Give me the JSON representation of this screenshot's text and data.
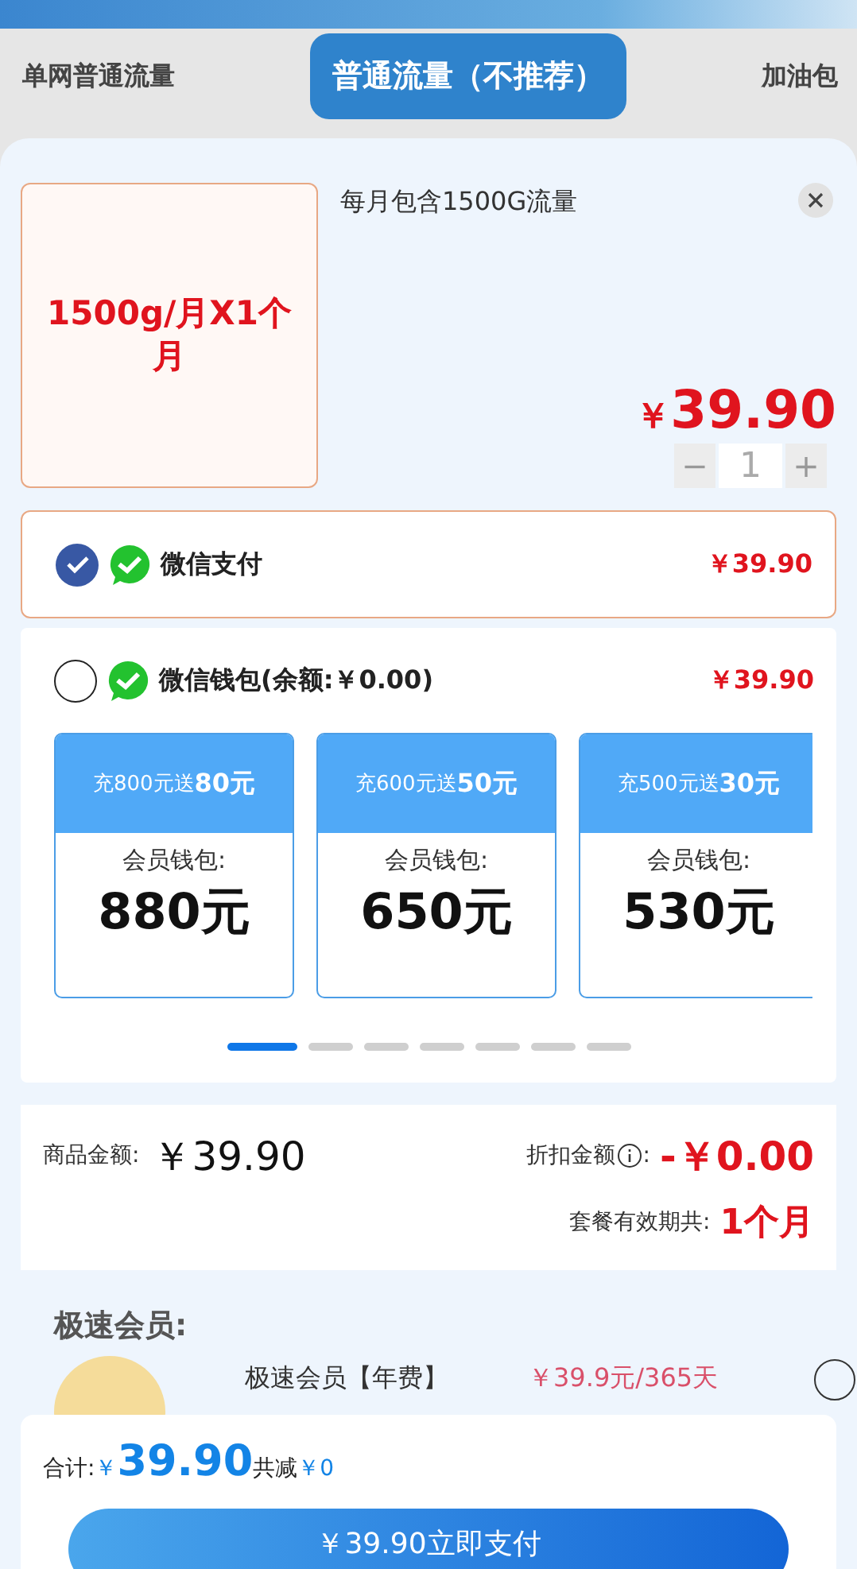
{
  "tabs": [
    {
      "label": "单网普通流量",
      "selected": false
    },
    {
      "label": "普通流量（不推荐）",
      "selected": true
    },
    {
      "label": "加油包",
      "selected": false
    }
  ],
  "product": {
    "card_text": "1500g/月X1个月",
    "description": "每月包含1500G流量",
    "price_symbol": "￥",
    "price": "39.90",
    "quantity": "1",
    "minus": "−",
    "plus": "+"
  },
  "payment_methods": [
    {
      "kind": "plain",
      "label": "微信支付",
      "price": "￥39.90",
      "selected": true
    },
    {
      "kind": "wallet",
      "label": "微信钱包(余额:￥0.00)",
      "price": "￥39.90",
      "selected": false
    }
  ],
  "wallet_offers": [
    {
      "promo": "充800元送**80元**",
      "label": "会员钱包:",
      "amount": "880元"
    },
    {
      "promo": "充600元送**50元**",
      "label": "会员钱包:",
      "amount": "650元"
    },
    {
      "promo": "充500元送**30元**",
      "label": "会员钱包:",
      "amount": "530元"
    }
  ],
  "pager": [
    {
      "selected": true
    },
    {
      "selected": false
    },
    {
      "selected": false
    },
    {
      "selected": false
    },
    {
      "selected": false
    },
    {
      "selected": false
    },
    {
      "selected": false
    }
  ],
  "summary": {
    "goods_label": "商品金额:",
    "goods_amount": "￥39.90",
    "discount_label": "折扣金额",
    "discount_suffix": ":",
    "discount_amount": "-￥0.00",
    "validity_label": "套餐有效期共:",
    "validity_value": "1个月"
  },
  "member": {
    "heading": "极速会员:",
    "item_name": "极速会员【年费】",
    "item_price": "￥39.9元/365天",
    "selected": false
  },
  "footer": {
    "total_label": "合计:",
    "total_symbol": "￥",
    "total_amount": "39.90",
    "saved_label": "共减",
    "saved_amount": "￥0",
    "pay_button": "￥39.90立即支付"
  }
}
